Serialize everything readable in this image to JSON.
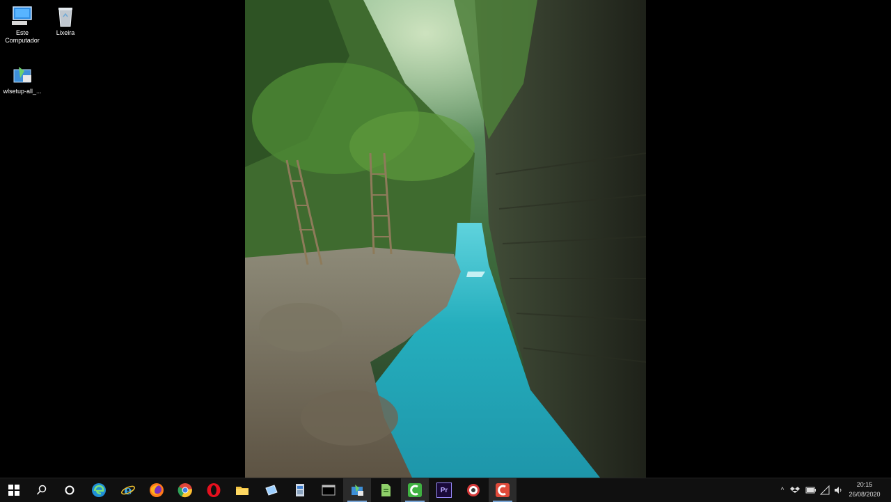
{
  "desktop": {
    "icons": [
      {
        "label": "Este Computador",
        "icon": "computer-icon"
      },
      {
        "label": "Lixeira",
        "icon": "recycle-bin-icon"
      },
      {
        "label": "wlsetup-all_...",
        "icon": "installer-icon"
      }
    ],
    "wallpaper": {
      "subject": "canyon-river-photo",
      "water_color": "#2bb3c0"
    }
  },
  "taskbar": {
    "apps": [
      {
        "name": "start-button",
        "icon": "windows-logo-icon"
      },
      {
        "name": "search-button",
        "icon": "search-icon"
      },
      {
        "name": "cortana-button",
        "icon": "circle-icon"
      },
      {
        "name": "edge-button",
        "icon": "edge-icon"
      },
      {
        "name": "ie-button",
        "icon": "internet-explorer-icon"
      },
      {
        "name": "firefox-button",
        "icon": "firefox-icon"
      },
      {
        "name": "chrome-button",
        "icon": "chrome-icon"
      },
      {
        "name": "opera-button",
        "icon": "opera-icon"
      },
      {
        "name": "file-explorer-button",
        "icon": "folder-icon"
      },
      {
        "name": "app-button-1",
        "icon": "window-icon"
      },
      {
        "name": "app-button-2",
        "icon": "document-icon"
      },
      {
        "name": "app-button-3",
        "icon": "terminal-icon"
      },
      {
        "name": "app-button-4",
        "icon": "installer-icon"
      },
      {
        "name": "app-button-5",
        "icon": "page-icon"
      },
      {
        "name": "camtasia-recorder-button",
        "icon": "recorder-icon"
      },
      {
        "name": "premiere-button",
        "icon": "premiere-icon",
        "label": "Pr"
      },
      {
        "name": "app-button-6",
        "icon": "target-icon"
      },
      {
        "name": "camtasia-button",
        "icon": "camtasia-icon"
      }
    ],
    "clock": {
      "time": "20:15",
      "date": "26/08/2020"
    },
    "accent": "#7aa7d8"
  }
}
